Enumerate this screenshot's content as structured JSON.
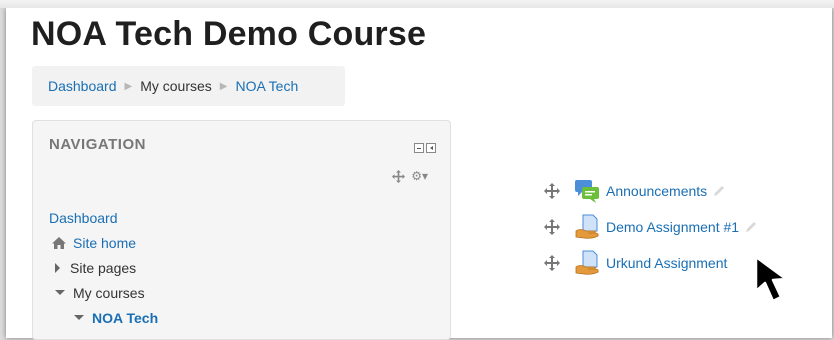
{
  "page": {
    "title": "NOA Tech Demo Course"
  },
  "breadcrumb": {
    "items": [
      "Dashboard",
      "My courses",
      "NOA Tech"
    ]
  },
  "navigation": {
    "title": "NAVIGATION",
    "items": [
      {
        "label": "Dashboard"
      },
      {
        "label": "Site home"
      },
      {
        "label": "Site pages"
      },
      {
        "label": "My courses"
      },
      {
        "label": "NOA Tech"
      }
    ]
  },
  "activities": [
    {
      "label": "Announcements",
      "icon": "forum-icon"
    },
    {
      "label": "Demo Assignment #1",
      "icon": "assignment-icon"
    },
    {
      "label": "Urkund Assignment",
      "icon": "assignment-icon"
    }
  ],
  "colors": {
    "link": "#1a6fb4",
    "title": "#1f1f1f",
    "block_bg": "#f5f5f5"
  }
}
